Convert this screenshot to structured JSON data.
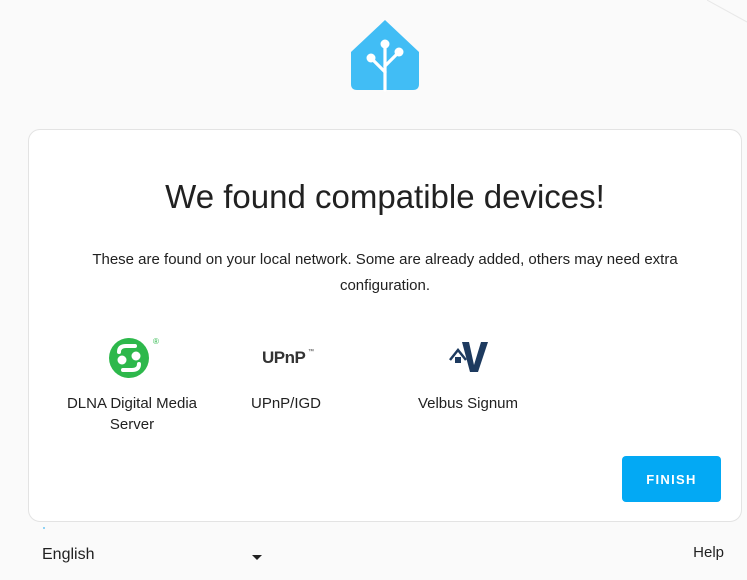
{
  "header": {
    "logo_icon": "home-assistant-logo-icon",
    "brand_color": "#41bdf5"
  },
  "card": {
    "title": "We found compatible devices!",
    "description": "These are found on your local network. Some are already added, others may need extra configuration.",
    "devices": [
      {
        "name": "DLNA Digital Media Server",
        "icon": "dlna-icon",
        "color": "#2db84b"
      },
      {
        "name": "UPnP/IGD",
        "icon": "upnp-icon",
        "color": "#333333"
      },
      {
        "name": "Velbus Signum",
        "icon": "velbus-icon",
        "color": "#1d3a5f"
      }
    ],
    "finish_label": "FINISH",
    "accent_color": "#03a9f4"
  },
  "footer": {
    "language": "English",
    "help_label": "Help"
  }
}
